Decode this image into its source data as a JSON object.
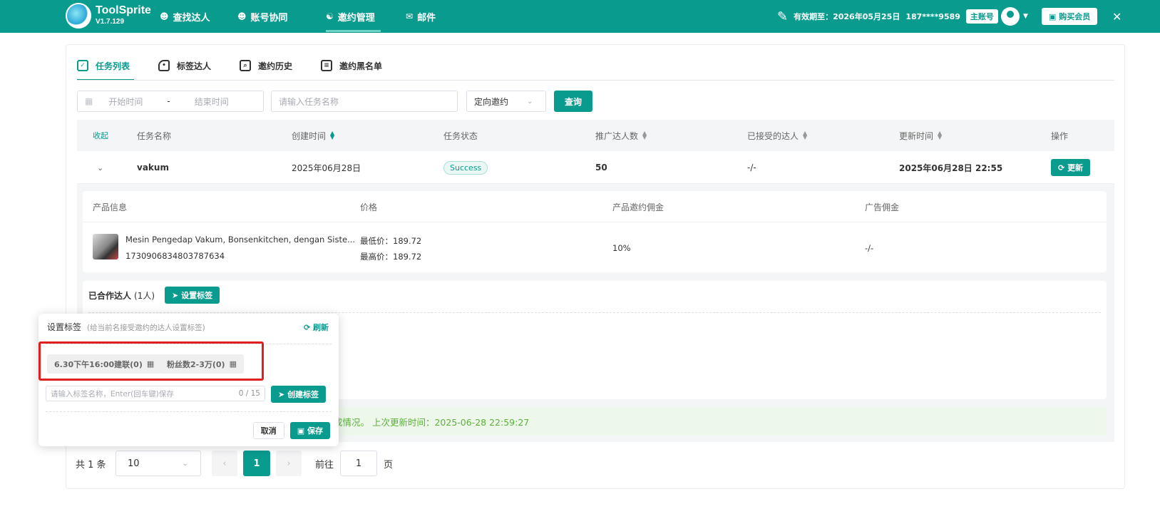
{
  "app": {
    "name": "ToolSprite",
    "version": "V1.7.129"
  },
  "nav": [
    {
      "label": "查找达人",
      "icon": "users-icon"
    },
    {
      "label": "账号协同",
      "icon": "group-icon"
    },
    {
      "label": "邀约管理",
      "icon": "invite-icon",
      "active": true
    },
    {
      "label": "邮件",
      "icon": "mail-icon"
    }
  ],
  "account": {
    "validity": "有效期至：2026年05月25日",
    "phone": "187****9589",
    "badge": "主账号",
    "buy": "购买会员"
  },
  "tabs": [
    {
      "label": "任务列表",
      "active": true
    },
    {
      "label": "标签达人"
    },
    {
      "label": "邀约历史"
    },
    {
      "label": "邀约黑名单"
    }
  ],
  "filters": {
    "start_placeholder": "开始时间",
    "separator": "-",
    "end_placeholder": "结束时间",
    "task_placeholder": "请输入任务名称",
    "type_value": "定向邀约",
    "query": "查询"
  },
  "table": {
    "collapse": "收起",
    "headers": [
      "任务名称",
      "创建时间",
      "任务状态",
      "推广达人数",
      "已接受的达人",
      "更新时间",
      "操作"
    ],
    "row": {
      "name": "vakum",
      "created": "2025年06月28日",
      "status": "Success",
      "promoted": "50",
      "accepted": "-/-",
      "updated": "2025年06月28日 22:55",
      "action": "更新"
    }
  },
  "product": {
    "headers": [
      "产品信息",
      "价格",
      "产品邀约佣金",
      "广告佣金"
    ],
    "title": "Mesin Pengedap Vakum, Bonsenkitchen, dengan Siste...",
    "id": "1730906834803787634",
    "min_price": "最低价：189.72",
    "max_price": "最高价：189.72",
    "commission": "10%",
    "ad_commission": "-/-"
  },
  "cooperation": {
    "title": "已合作达人",
    "count": "(1人)",
    "set_tag": "设置标签"
  },
  "notice": "约达成情况。 上次更新时间：2025-06-28 22:59:27",
  "pagination": {
    "total": "共 1 条",
    "page_size": "10",
    "current": "1",
    "goto_label": "前往",
    "goto_value": "1",
    "page_unit": "页"
  },
  "popup": {
    "title": "设置标签",
    "subtitle": "(给当前名接受邀约的达人设置标签)",
    "refresh": "刷新",
    "tags": [
      "6.30下午16:00建联(0)",
      "粉丝数2-3万(0)"
    ],
    "input_placeholder": "请输入标签名称，Enter(回车键)保存",
    "counter": "0 / 15",
    "create": "创建标签",
    "cancel": "取消",
    "save": "保存"
  }
}
